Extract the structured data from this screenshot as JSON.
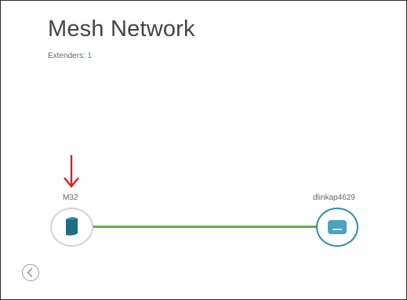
{
  "page": {
    "title": "Mesh Network"
  },
  "extenders": {
    "label": "Extenders:",
    "count": "1"
  },
  "nodes": [
    {
      "label": "M32",
      "icon": "mesh-extender-icon"
    },
    {
      "label": "dlinkap4629",
      "icon": "router-icon"
    }
  ],
  "navigation": {
    "back_icon": "chevron-left-icon"
  },
  "colors": {
    "link": "#5fb043",
    "accent": "#2f8fa3",
    "arrow": "#e02020",
    "count": "#3a8fb7"
  }
}
